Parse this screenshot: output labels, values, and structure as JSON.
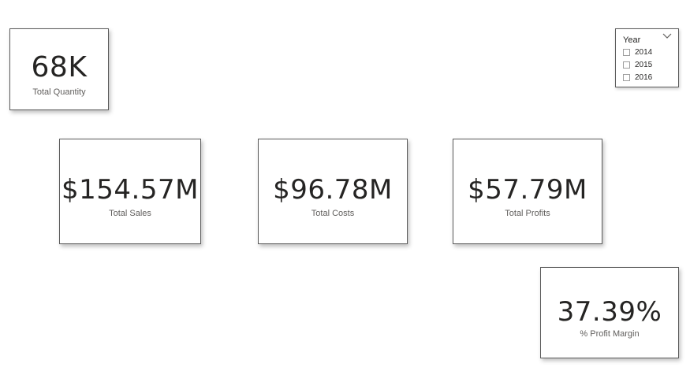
{
  "cards": {
    "quantity": {
      "value": "68K",
      "label": "Total Quantity"
    },
    "sales": {
      "value": "$154.57M",
      "label": "Total Sales"
    },
    "costs": {
      "value": "$96.78M",
      "label": "Total Costs"
    },
    "profits": {
      "value": "$57.79M",
      "label": "Total Profits"
    },
    "margin": {
      "value": "37.39%",
      "label": "% Profit Margin"
    }
  },
  "slicer": {
    "title": "Year",
    "icon": "chevron-down-icon",
    "options": [
      {
        "label": "2014",
        "checked": false
      },
      {
        "label": "2015",
        "checked": false
      },
      {
        "label": "2016",
        "checked": false
      }
    ]
  },
  "colors": {
    "value_text": "#252423",
    "label_text": "#605e5c",
    "card_border": "#5a5a5a"
  }
}
